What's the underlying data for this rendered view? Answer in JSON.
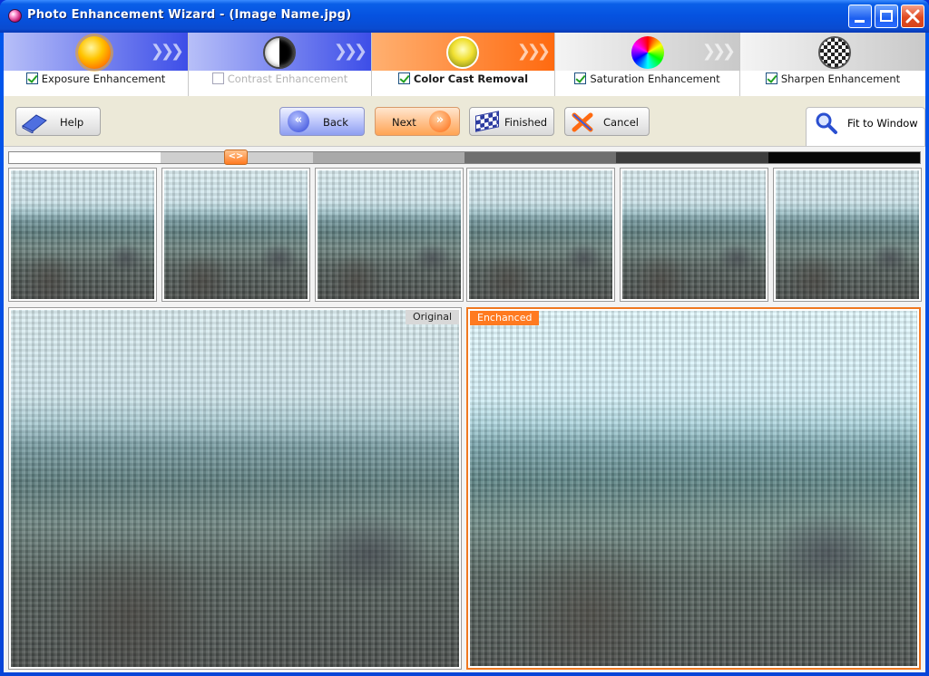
{
  "window": {
    "title": "Photo Enhancement Wizard - (Image Name.jpg)"
  },
  "steps": [
    {
      "label": "Exposure Enhancement",
      "checked": true,
      "icon": "sun-icon"
    },
    {
      "label": "Contrast Enhancement",
      "checked": false,
      "icon": "contrast-icon"
    },
    {
      "label": "Color Cast Removal",
      "checked": true,
      "icon": "lightbulb-icon"
    },
    {
      "label": "Saturation Enhancement",
      "checked": true,
      "icon": "color-wheel-icon"
    },
    {
      "label": "Sharpen Enhancement",
      "checked": true,
      "icon": "checkerboard-icon"
    }
  ],
  "toolbar": {
    "help": "Help",
    "back": "Back",
    "next": "Next",
    "finished": "Finished",
    "cancel": "Cancel",
    "fit": "Fit to Window"
  },
  "slider": {
    "handle_text": "<>",
    "selected_index": 1,
    "steps": 6
  },
  "preview": {
    "original_label": "Original",
    "enhanced_label": "Enchanced"
  },
  "colors": {
    "accent_orange": "#ff7a20",
    "accent_blue": "#3d4ee8",
    "title_blue": "#0552e0"
  }
}
